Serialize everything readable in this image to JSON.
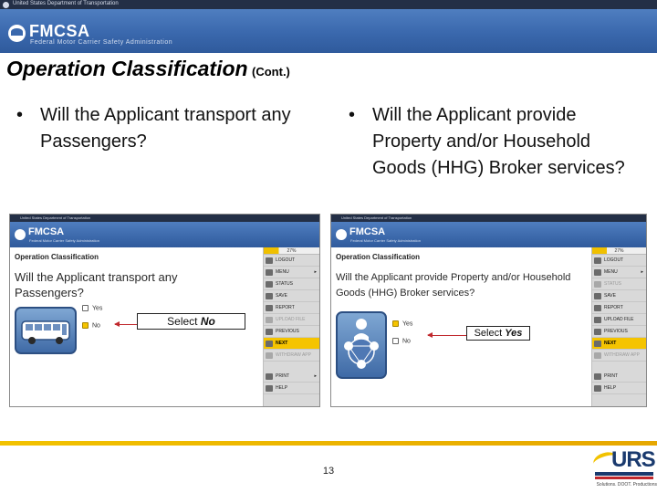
{
  "slide": {
    "agency_bar": "United States Department of Transportation",
    "brand_title": "FMCSA",
    "brand_sub": "Federal Motor Carrier Safety Administration",
    "title": "Operation Classification",
    "title_suffix": "(Cont.)",
    "bullet_mark": "•",
    "bullet_left": "Will the Applicant transport any Passengers?",
    "bullet_right": "Will the Applicant provide Property and/or Household Goods (HHG) Broker services?",
    "page_number": "13",
    "footer_logo": "URS",
    "footer_tagline": "Solutions. DOOT. Productions"
  },
  "screenshot_left": {
    "agency_bar": "United States Department of Transportation",
    "brand_title": "FMCSA",
    "brand_sub": "Federal Motor Carrier Safety Administration",
    "page_title": "Operation Classification",
    "question_line1": "Will the Applicant transport any",
    "question_line2": "Passengers?",
    "options": [
      {
        "label": "Yes",
        "checked": false
      },
      {
        "label": "No",
        "checked": true
      }
    ],
    "callout_prefix": "Select ",
    "callout_value": "No",
    "icon": "bus-icon"
  },
  "screenshot_right": {
    "agency_bar": "United States Department of Transportation",
    "brand_title": "FMCSA",
    "brand_sub": "Federal Motor Carrier Safety Administration",
    "page_title": "Operation Classification",
    "question_line1": "Will the Applicant provide Property and/or Household",
    "question_line2": "Goods (HHG) Broker services?",
    "options": [
      {
        "label": "Yes",
        "checked": true
      },
      {
        "label": "No",
        "checked": false
      }
    ],
    "callout_prefix": "Select ",
    "callout_value": "Yes",
    "icon": "broker-network-icon"
  },
  "menu_left": {
    "progress": "27%",
    "progress_value": 27,
    "items": [
      "LOGOUT",
      "MENU",
      "STATUS",
      "SAVE",
      "REPORT",
      "UPLOAD FILE",
      "PREVIOUS",
      "NEXT",
      "WITHDRAW APP",
      "PRINT",
      "HELP"
    ]
  },
  "menu_right": {
    "progress": "27%",
    "progress_value": 27,
    "items": [
      "LOGOUT",
      "MENU",
      "STATUS",
      "SAVE",
      "REPORT",
      "UPLOAD FILE",
      "PREVIOUS",
      "NEXT",
      "WITHDRAW APP",
      "PRINT",
      "HELP"
    ]
  },
  "colors": {
    "header_blue": "#3a68ad",
    "dark_bar": "#232f46",
    "accent_yellow": "#f5c400",
    "arrow_red": "#c0282d"
  }
}
